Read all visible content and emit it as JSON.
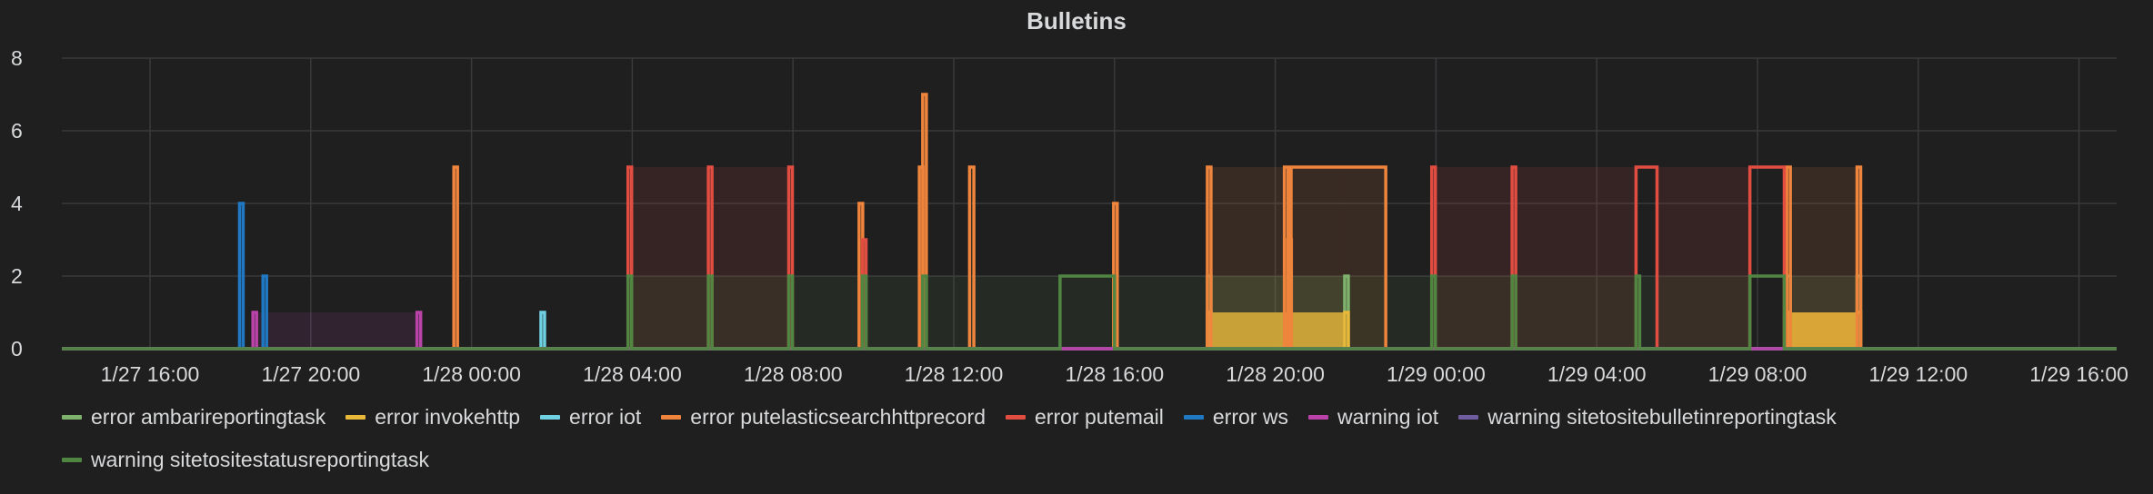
{
  "panel": {
    "title": "Bulletins"
  },
  "chart_data": {
    "type": "line",
    "title": "Bulletins",
    "xlabel": "",
    "ylabel": "",
    "ylim": [
      0,
      8
    ],
    "grid": true,
    "legend_position": "bottom",
    "x_ticks": [
      "1/27 16:00",
      "1/27 20:00",
      "1/28 00:00",
      "1/28 04:00",
      "1/28 08:00",
      "1/28 12:00",
      "1/28 16:00",
      "1/28 20:00",
      "1/29 00:00",
      "1/29 04:00",
      "1/29 08:00",
      "1/29 12:00",
      "1/29 16:00"
    ],
    "y_ticks": [
      0,
      2,
      4,
      6,
      8
    ],
    "series": [
      {
        "name": "error ambarireportingtask",
        "color": "#7eb26d",
        "points": [
          [
            "1/28 18:20",
            2
          ],
          [
            "1/28 21:45",
            2
          ],
          [
            "1/29 08:45",
            2
          ],
          [
            "1/29 10:30",
            2
          ]
        ]
      },
      {
        "name": "error invokehttp",
        "color": "#eab839",
        "points": [
          [
            "1/28 18:20",
            1
          ],
          [
            "1/28 21:45",
            1
          ],
          [
            "1/29 08:45",
            1
          ],
          [
            "1/29 10:30",
            1
          ]
        ]
      },
      {
        "name": "error iot",
        "color": "#6ed0e0",
        "points": [
          [
            "1/28 01:45",
            1
          ]
        ]
      },
      {
        "name": "error putelasticsearchhttprecord",
        "color": "#ef843c",
        "points": [
          [
            "1/27 23:35",
            5
          ],
          [
            "1/28 09:40",
            4
          ],
          [
            "1/28 11:10",
            5
          ],
          [
            "1/28 11:15",
            7
          ],
          [
            "1/28 12:25",
            5
          ],
          [
            "1/28 12:30",
            5
          ],
          [
            "1/28 16:00",
            4
          ],
          [
            "1/28 18:20",
            5
          ],
          [
            "1/28 20:15",
            5
          ],
          [
            "1/28 20:20",
            3
          ],
          [
            "1/28 20:25",
            5
          ],
          [
            "1/28 21:45",
            5
          ],
          [
            "1/28 22:45",
            5
          ],
          [
            "1/29 08:45",
            5
          ],
          [
            "1/29 10:30",
            5
          ]
        ]
      },
      {
        "name": "error putemail",
        "color": "#e24d42",
        "points": [
          [
            "1/28 03:55",
            5
          ],
          [
            "1/28 05:55",
            5
          ],
          [
            "1/28 07:55",
            5
          ],
          [
            "1/28 09:45",
            3
          ],
          [
            "1/28 23:55",
            5
          ],
          [
            "1/29 01:55",
            5
          ],
          [
            "1/29 05:00",
            5
          ],
          [
            "1/29 05:10",
            5
          ],
          [
            "1/29 05:20",
            5
          ],
          [
            "1/29 05:30",
            5
          ],
          [
            "1/29 07:50",
            5
          ],
          [
            "1/29 08:00",
            5
          ],
          [
            "1/29 08:10",
            5
          ],
          [
            "1/29 08:20",
            5
          ],
          [
            "1/29 08:40",
            5
          ]
        ]
      },
      {
        "name": "error ws",
        "color": "#1f78c1",
        "points": [
          [
            "1/27 18:15",
            4
          ],
          [
            "1/27 18:50",
            2
          ]
        ]
      },
      {
        "name": "warning iot",
        "color": "#ba43a9",
        "points": [
          [
            "1/27 18:35",
            1
          ],
          [
            "1/27 22:40",
            1
          ]
        ]
      },
      {
        "name": "warning sitetositebulletinreportingtask",
        "color": "#705da0",
        "points": []
      },
      {
        "name": "warning sitetositestatusreportingtask",
        "color": "#508642",
        "points": [
          [
            "1/28 03:55",
            2
          ],
          [
            "1/28 05:55",
            2
          ],
          [
            "1/28 07:55",
            2
          ],
          [
            "1/28 09:45",
            2
          ],
          [
            "1/28 11:15",
            2
          ],
          [
            "1/28 14:40",
            2
          ],
          [
            "1/28 16:00",
            2
          ],
          [
            "1/28 23:55",
            2
          ],
          [
            "1/29 01:55",
            2
          ],
          [
            "1/29 05:00",
            2
          ],
          [
            "1/29 07:50",
            2
          ],
          [
            "1/29 08:00",
            2
          ],
          [
            "1/29 08:40",
            2
          ]
        ]
      }
    ]
  }
}
